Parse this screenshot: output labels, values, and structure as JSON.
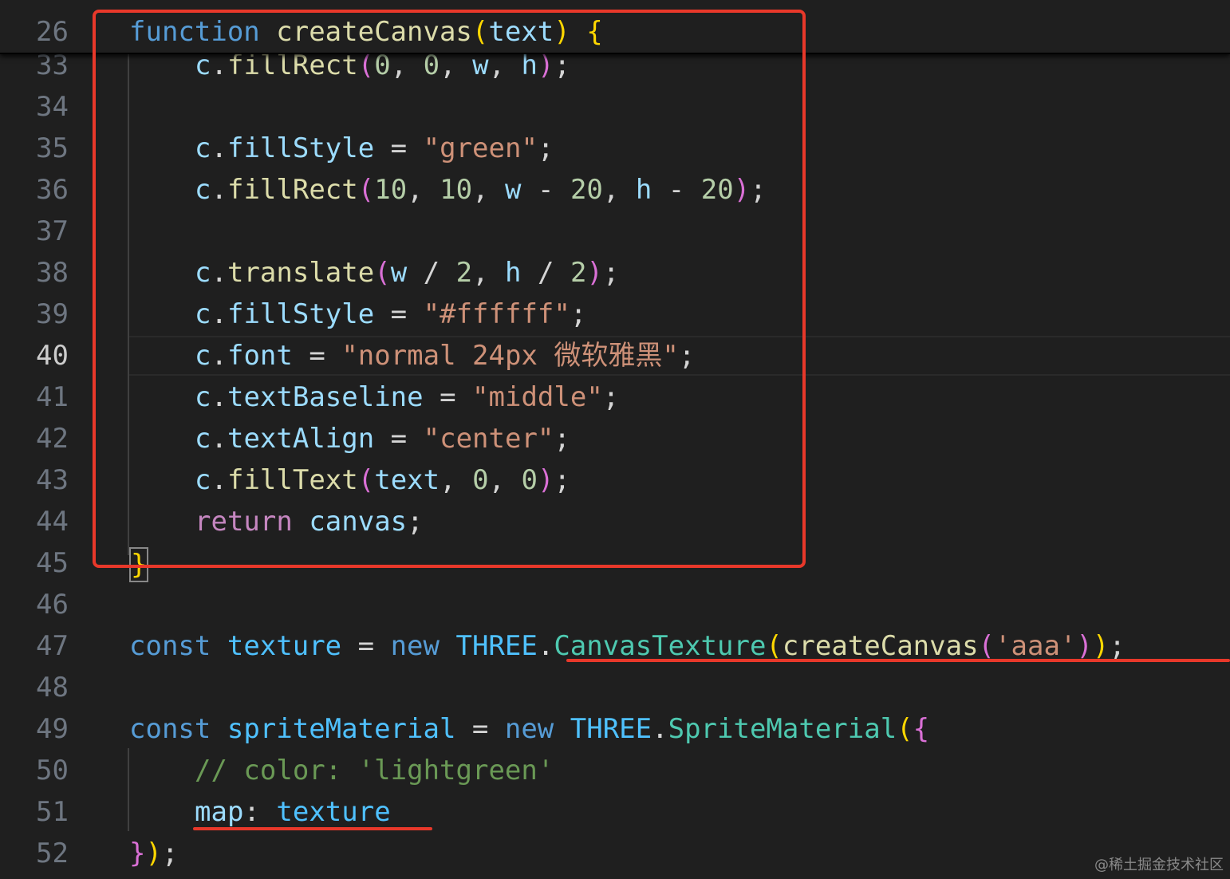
{
  "sticky": {
    "line_number": "26",
    "tokens": [
      "function",
      " ",
      "createCanvas",
      "(",
      "text",
      ")",
      " ",
      "{"
    ]
  },
  "lines": [
    {
      "n": "33",
      "t": [
        "c",
        ".",
        "fillRect",
        "(",
        "0",
        ", ",
        "0",
        ", ",
        "w",
        ", ",
        "h",
        ")",
        ";"
      ]
    },
    {
      "n": "34",
      "t": []
    },
    {
      "n": "35",
      "t": [
        "c",
        ".",
        "fillStyle",
        " = ",
        "\"green\"",
        ";"
      ]
    },
    {
      "n": "36",
      "t": [
        "c",
        ".",
        "fillRect",
        "(",
        "10",
        ", ",
        "10",
        ", ",
        "w",
        " - ",
        "20",
        ", ",
        "h",
        " - ",
        "20",
        ")",
        ";"
      ]
    },
    {
      "n": "37",
      "t": []
    },
    {
      "n": "38",
      "t": [
        "c",
        ".",
        "translate",
        "(",
        "w",
        " / ",
        "2",
        ", ",
        "h",
        " / ",
        "2",
        ")",
        ";"
      ]
    },
    {
      "n": "39",
      "t": [
        "c",
        ".",
        "fillStyle",
        " = ",
        "\"#ffffff\"",
        ";"
      ]
    },
    {
      "n": "40",
      "t": [
        "c",
        ".",
        "font",
        " = ",
        "\"normal 24px 微软雅黑\"",
        ";"
      ]
    },
    {
      "n": "41",
      "t": [
        "c",
        ".",
        "textBaseline",
        " = ",
        "\"middle\"",
        ";"
      ]
    },
    {
      "n": "42",
      "t": [
        "c",
        ".",
        "textAlign",
        " = ",
        "\"center\"",
        ";"
      ]
    },
    {
      "n": "43",
      "t": [
        "c",
        ".",
        "fillText",
        "(",
        "text",
        ", ",
        "0",
        ", ",
        "0",
        ")",
        ";"
      ]
    },
    {
      "n": "44",
      "t": [
        "return",
        " ",
        "canvas",
        ";"
      ]
    },
    {
      "n": "45",
      "t": [
        "}"
      ]
    },
    {
      "n": "46",
      "t": []
    },
    {
      "n": "47",
      "t": [
        "const",
        " ",
        "texture",
        " = ",
        "new",
        " ",
        "THREE",
        ".",
        "CanvasTexture",
        "(",
        "createCanvas",
        "(",
        "'aaa'",
        ")",
        ")",
        ";"
      ]
    },
    {
      "n": "48",
      "t": []
    },
    {
      "n": "49",
      "t": [
        "const",
        " ",
        "spriteMaterial",
        " = ",
        "new",
        " ",
        "THREE",
        ".",
        "SpriteMaterial",
        "(",
        "{"
      ]
    },
    {
      "n": "50",
      "t": [
        "// color: 'lightgreen'"
      ]
    },
    {
      "n": "51",
      "t": [
        "map",
        ": ",
        "texture"
      ]
    },
    {
      "n": "52",
      "t": [
        "}",
        ")",
        ";"
      ]
    }
  ],
  "colors": {
    "annotation": "#e8382a",
    "background": "#1f1f1f"
  },
  "watermark": "@稀土掘金技术社区"
}
